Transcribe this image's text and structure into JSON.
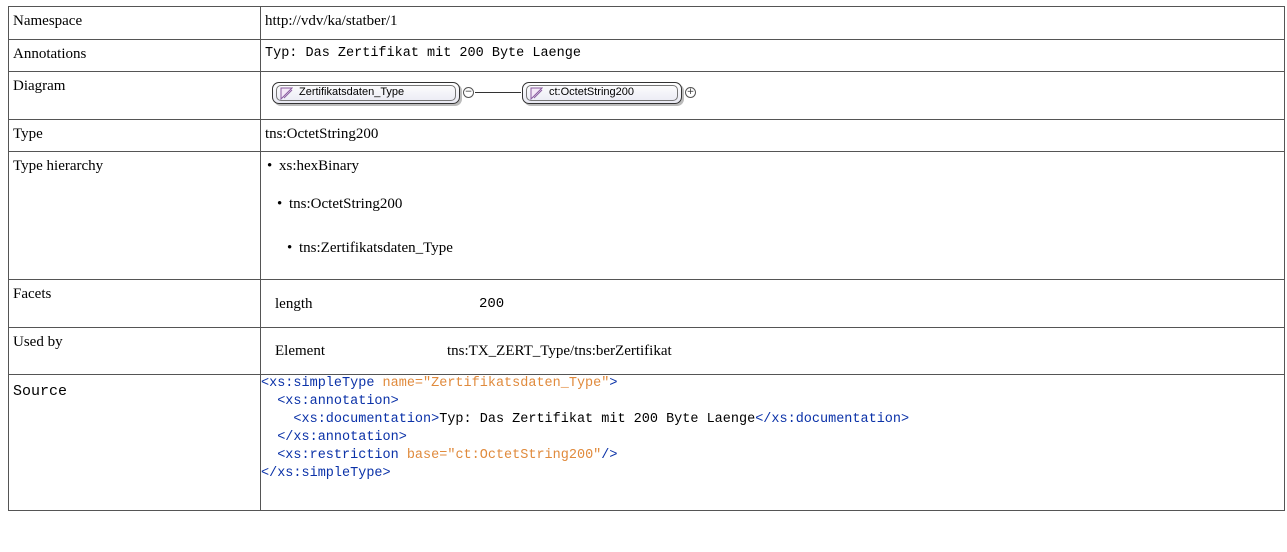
{
  "rows": {
    "namespace": {
      "label": "Namespace",
      "value": "http://vdv/ka/statber/1"
    },
    "annotations": {
      "label": "Annotations",
      "value": "Typ: Das Zertifikat mit 200 Byte Laenge"
    },
    "diagram": {
      "label": "Diagram",
      "node1": "Zertifikatsdaten_Type",
      "node2": "ct:OctetString200"
    },
    "type": {
      "label": "Type",
      "value": "tns:OctetString200"
    },
    "hierarchy": {
      "label": "Type hierarchy",
      "items": [
        "xs:hexBinary",
        "tns:OctetString200",
        "tns:Zertifikatsdaten_Type"
      ]
    },
    "facets": {
      "label": "Facets",
      "name": "length",
      "value": "200"
    },
    "usedby": {
      "label": "Used by",
      "kind": "Element",
      "value": "tns:TX_ZERT_Type/tns:berZertifikat"
    },
    "source": {
      "label": "Source",
      "line1_open": "<xs:simpleType",
      "line1_attr": " name=\"Zertifikatsdaten_Type\"",
      "line1_close": ">",
      "line2": "<xs:annotation>",
      "line3_open": "<xs:documentation>",
      "line3_text": "Typ: Das Zertifikat mit 200 Byte Laenge",
      "line3_close": "</xs:documentation>",
      "line4": "</xs:annotation>",
      "line5_open": "<xs:restriction",
      "line5_attr": " base=\"ct:OctetString200\"",
      "line5_close": "/>",
      "line6": "</xs:simpleType>"
    }
  },
  "colors": {
    "tag": "#0b32a8",
    "attribute": "#e08a3c",
    "border": "#555555"
  },
  "icons": [
    "simple-type-icon",
    "collapse-icon",
    "expand-icon"
  ]
}
